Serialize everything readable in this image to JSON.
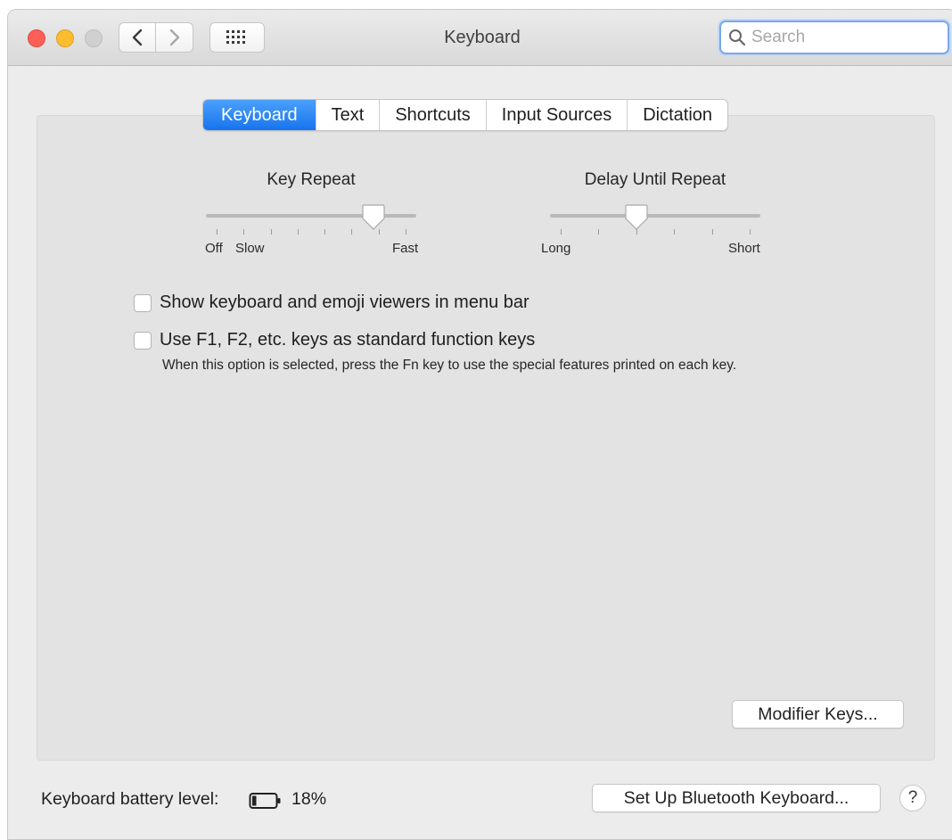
{
  "window": {
    "title": "Keyboard"
  },
  "toolbar": {
    "back_icon": "chevron-left-icon",
    "forward_icon": "chevron-right-icon",
    "grid_icon": "grid-icon"
  },
  "search": {
    "placeholder": "Search",
    "value": ""
  },
  "tabs": [
    {
      "label": "Keyboard",
      "selected": true
    },
    {
      "label": "Text",
      "selected": false
    },
    {
      "label": "Shortcuts",
      "selected": false
    },
    {
      "label": "Input Sources",
      "selected": false
    },
    {
      "label": "Dictation",
      "selected": false
    }
  ],
  "key_repeat": {
    "title": "Key Repeat",
    "labels": {
      "off": "Off",
      "slow": "Slow",
      "fast": "Fast"
    },
    "position_fraction": 0.83,
    "tick_count": 8
  },
  "delay_until_repeat": {
    "title": "Delay Until Repeat",
    "labels": {
      "long": "Long",
      "short": "Short"
    },
    "position_fraction": 0.4,
    "tick_count": 6
  },
  "options": {
    "show_viewers": {
      "label": "Show keyboard and emoji viewers in menu bar",
      "checked": false
    },
    "function_keys": {
      "label": "Use F1, F2, etc. keys as standard function keys",
      "checked": false,
      "note": "When this option is selected, press the Fn key to use the special features printed on each key."
    }
  },
  "buttons": {
    "modifier_keys": "Modifier Keys...",
    "bluetooth_setup": "Set Up Bluetooth Keyboard...",
    "help": "?"
  },
  "battery": {
    "label": "Keyboard battery level:",
    "level": "18%",
    "level_fraction": 0.18
  },
  "colors": {
    "accent": "#1774ee",
    "close": "#fc5f57",
    "minimize": "#fdbc2e"
  }
}
